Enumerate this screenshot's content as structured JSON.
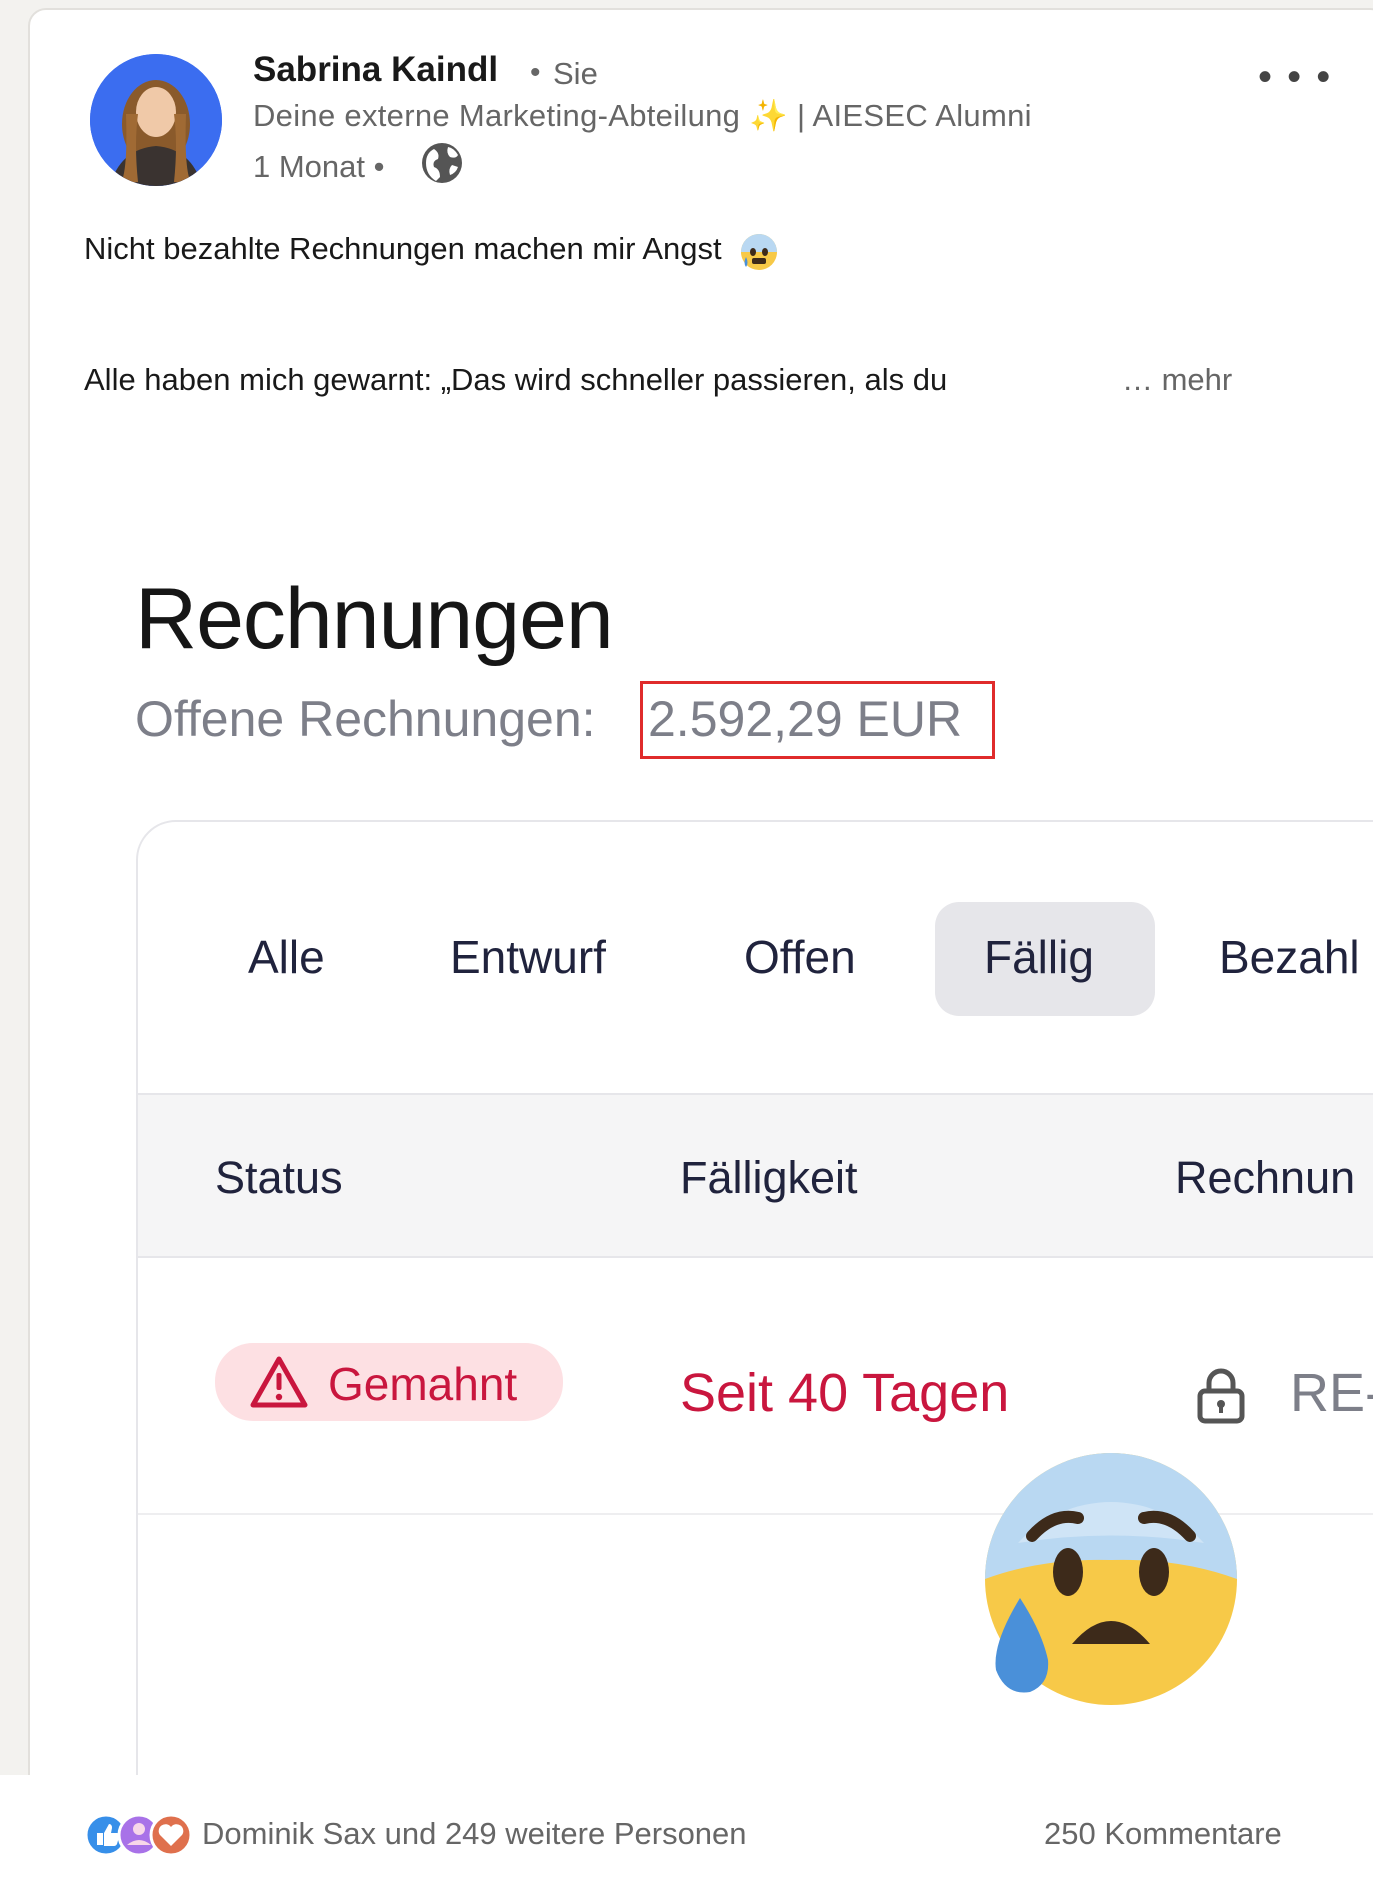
{
  "author": {
    "name": "Sabrina Kaindl",
    "separator": "•",
    "degree": "Sie",
    "headline_prefix": "Deine externe Marketing-Abteilung",
    "headline_sparkle": "✨",
    "headline_suffix": "| AIESEC Alumni",
    "time": "1 Monat •"
  },
  "post": {
    "line1": "Nicht bezahlte Rechnungen machen mir Angst",
    "line2": "Alle haben mich gewarnt: „Das wird schneller passieren, als du",
    "more": "… mehr",
    "more_menu": "• • •"
  },
  "image": {
    "title": "Rechnungen",
    "open_label": "Offene Rechnungen:",
    "open_amount": "2.592,29 EUR",
    "tabs": [
      {
        "label": "Alle",
        "active": false
      },
      {
        "label": "Entwurf",
        "active": false
      },
      {
        "label": "Offen",
        "active": false
      },
      {
        "label": "Fällig",
        "active": true
      },
      {
        "label": "Bezahl",
        "active": false
      }
    ],
    "columns": [
      "Status",
      "Fälligkeit",
      "Rechnun"
    ],
    "row": {
      "status": "Gemahnt",
      "due": "Seit 40 Tagen",
      "invoice": "RE-"
    }
  },
  "social": {
    "reactions": "Dominik Sax und 249 weitere Personen",
    "comments": "250 Kommentare"
  },
  "colors": {
    "accent_red": "#c9163e",
    "badge_bg": "#fde0e3",
    "highlight_box": "#e02b2b",
    "avatar_bg": "#3b6df0"
  },
  "icons": [
    "globe-icon",
    "more-icon",
    "fearful-emoji-icon",
    "warning-icon",
    "lock-icon",
    "like-reaction-icon",
    "support-reaction-icon",
    "love-reaction-icon"
  ]
}
